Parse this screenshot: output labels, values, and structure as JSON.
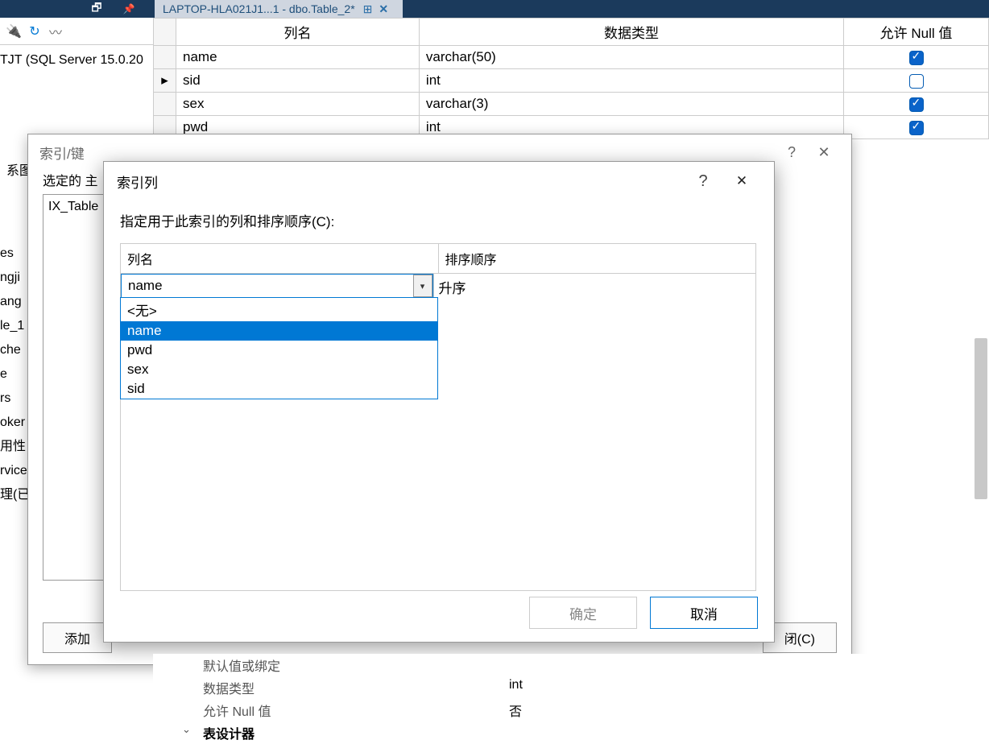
{
  "titlebar": {
    "tab_label": "LAPTOP-HLA021J1...1 - dbo.Table_2*"
  },
  "server_label": "TJT (SQL Server 15.0.20",
  "grid": {
    "headers": {
      "col": "列名",
      "type": "数据类型",
      "null": "允许 Null 值"
    },
    "rows": [
      {
        "col": "name",
        "type": "varchar(50)",
        "null": true,
        "selected": false
      },
      {
        "col": "sid",
        "type": "int",
        "null": false,
        "selected": true
      },
      {
        "col": "sex",
        "type": "varchar(3)",
        "null": true,
        "selected": false
      },
      {
        "col": "pwd",
        "type": "int",
        "null": true,
        "selected": false
      }
    ]
  },
  "dlg1": {
    "title": "索引/键",
    "label": "选定的 主",
    "listitem": "IX_Table",
    "add_btn": "添加",
    "close_btn": "闭(C)"
  },
  "sidebar_graph": "系图",
  "sidebar_items": [
    "es",
    "",
    "ngji",
    "ang",
    "le_1",
    "che",
    "e",
    "rs",
    "",
    "",
    "oker",
    "",
    "",
    "用性",
    "",
    "rvices 目录",
    "理(已禁用代理 XP)"
  ],
  "dlg2": {
    "title": "索引列",
    "instr": "指定用于此索引的列和排序顺序(C):",
    "header_col": "列名",
    "header_sort": "排序顺序",
    "selected_value": "name",
    "sort_value": "升序",
    "options": [
      "<无>",
      "name",
      "pwd",
      "sex",
      "sid"
    ],
    "selected_index": 1,
    "ok": "确定",
    "cancel": "取消"
  },
  "props": {
    "rows": [
      {
        "k": "默认值或绑定",
        "v": ""
      },
      {
        "k": "数据类型",
        "v": "int"
      },
      {
        "k": "允许 Null 值",
        "v": "否"
      }
    ],
    "expander": "表设计器"
  }
}
